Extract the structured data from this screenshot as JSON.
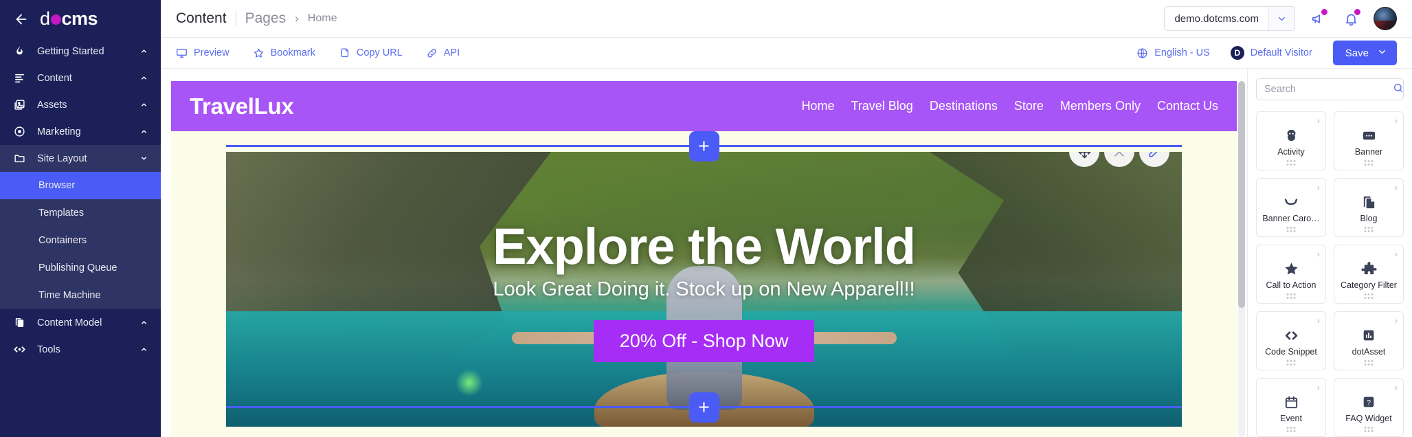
{
  "sidebar": {
    "back_icon": "arrow-left-icon",
    "logo": {
      "part1": "d",
      "dot": "",
      "part2": "cms"
    },
    "items": [
      {
        "label": "Getting Started",
        "icon": "flame-icon",
        "caret": "chevron-up-icon"
      },
      {
        "label": "Content",
        "icon": "lines-icon",
        "caret": "chevron-up-icon"
      },
      {
        "label": "Assets",
        "icon": "images-icon",
        "caret": "chevron-up-icon"
      },
      {
        "label": "Marketing",
        "icon": "target-icon",
        "caret": "chevron-up-icon"
      },
      {
        "label": "Site Layout",
        "icon": "folder-icon",
        "caret": "chevron-down-icon"
      },
      {
        "label": "Content Model",
        "icon": "copy-icon",
        "caret": "chevron-up-icon"
      },
      {
        "label": "Tools",
        "icon": "code-arrows-icon",
        "caret": "chevron-up-icon"
      }
    ],
    "sub_items": [
      {
        "label": "Browser",
        "active": true
      },
      {
        "label": "Templates",
        "active": false
      },
      {
        "label": "Containers",
        "active": false
      },
      {
        "label": "Publishing Queue",
        "active": false
      },
      {
        "label": "Time Machine",
        "active": false
      }
    ]
  },
  "header": {
    "breadcrumb": {
      "section": "Content",
      "area": "Pages",
      "separator": "›",
      "page": "Home"
    },
    "site_selector": {
      "value": "demo.dotcms.com",
      "chevron": "chevron-down-icon"
    },
    "announcements_icon": "megaphone-icon",
    "notifications_icon": "bell-icon",
    "avatar": "user-avatar",
    "badge_color": "#c518c4"
  },
  "actionbar": {
    "left": [
      {
        "label": "Preview",
        "icon": "monitor-icon"
      },
      {
        "label": "Bookmark",
        "icon": "star-icon"
      },
      {
        "label": "Copy URL",
        "icon": "copy-icon"
      },
      {
        "label": "API",
        "icon": "link-icon"
      }
    ],
    "language": {
      "label": "English - US",
      "icon": "globe-icon"
    },
    "persona": {
      "label": "Default Visitor",
      "badge": "D"
    },
    "save": {
      "label": "Save",
      "chevron": "chevron-down-icon"
    },
    "accent_color": "#4a5cf5"
  },
  "page": {
    "site_title": "TravelLux",
    "nav": [
      "Home",
      "Travel Blog",
      "Destinations",
      "Store",
      "Members Only",
      "Contact Us"
    ],
    "header_color": "#a855f7",
    "hero": {
      "title": "Explore the World",
      "subtitle": "Look Great Doing it. Stock up on New Apparell!!",
      "cta_label": "20% Off - Shop Now",
      "cta_color": "#a62df5"
    },
    "contentlet_tools": [
      {
        "name": "move",
        "icon": "move-icon"
      },
      {
        "name": "remove",
        "icon": "close-icon"
      },
      {
        "name": "edit",
        "icon": "pencil-icon"
      }
    ],
    "add_button_label": "+"
  },
  "palette": {
    "search": {
      "value": "",
      "placeholder": "Search",
      "icon": "search-icon"
    },
    "cards": [
      {
        "label": "Activity",
        "icon": "activity-icon"
      },
      {
        "label": "Banner",
        "icon": "banner-icon"
      },
      {
        "label": "Banner Caro…",
        "icon": "carousel-icon"
      },
      {
        "label": "Blog",
        "icon": "blog-icon"
      },
      {
        "label": "Call to Action",
        "icon": "star-icon"
      },
      {
        "label": "Category Filter",
        "icon": "puzzle-icon"
      },
      {
        "label": "Code Snippet",
        "icon": "code-icon"
      },
      {
        "label": "dotAsset",
        "icon": "chart-icon"
      },
      {
        "label": "Event",
        "icon": "calendar-icon"
      },
      {
        "label": "FAQ Widget",
        "icon": "question-icon"
      }
    ]
  }
}
